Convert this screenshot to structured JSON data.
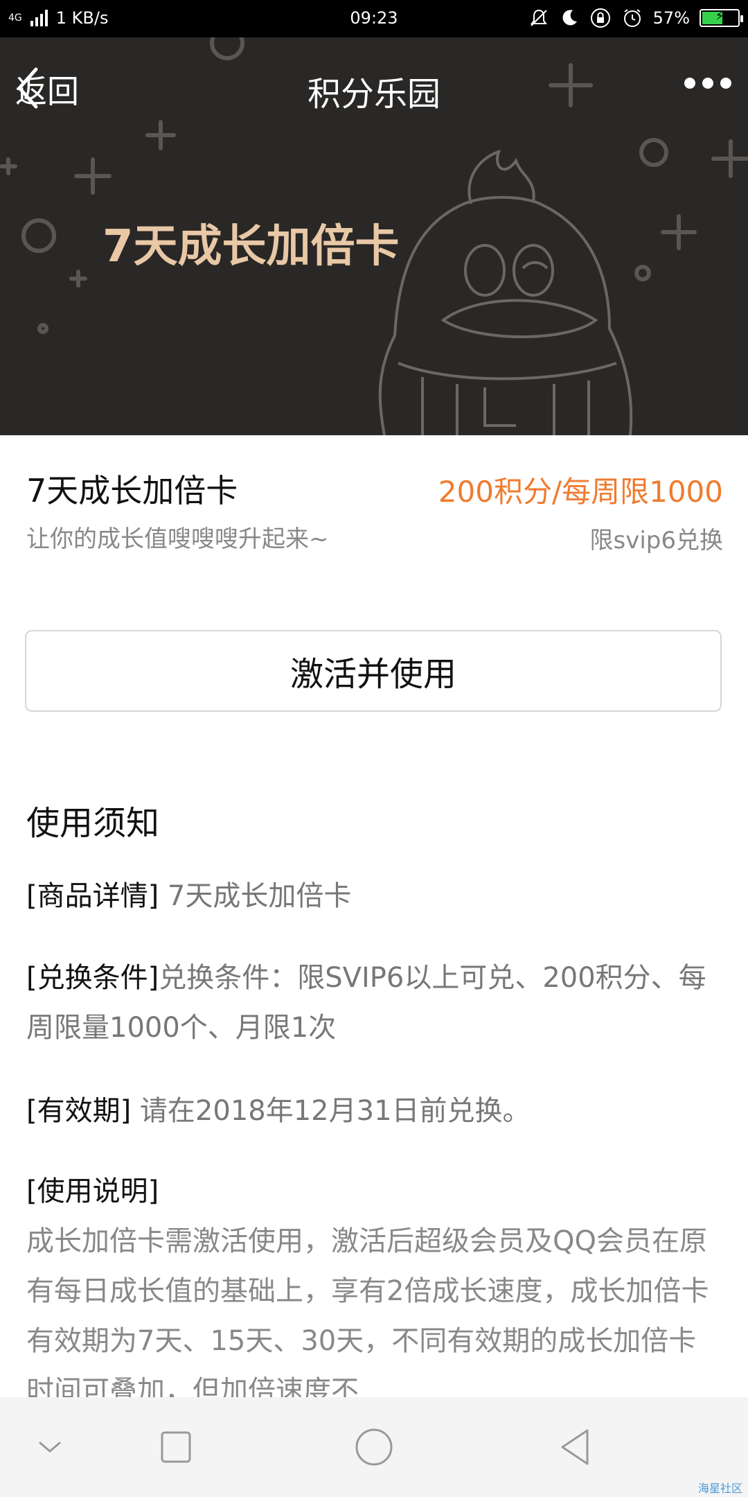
{
  "status_bar": {
    "network": "4G",
    "speed": "1 KB/s",
    "time": "09:23",
    "battery": "57%",
    "battery_level": 0.57
  },
  "header": {
    "back_label": "返回",
    "title": "积分乐园"
  },
  "banner": {
    "title": "7天成长加倍卡"
  },
  "product": {
    "name": "7天成长加倍卡",
    "price": "200积分/每周限1000",
    "subtitle": "让你的成长值嗖嗖嗖升起来~",
    "limit": "限svip6兑换"
  },
  "activate_button": "激活并使用",
  "notice": {
    "heading": "使用须知",
    "items": [
      {
        "tag": "[商品详情]",
        "text": " 7天成长加倍卡"
      },
      {
        "tag": "[兑换条件]",
        "text": "兑换条件：限SVIP6以上可兑、200积分、每周限量1000个、月限1次"
      },
      {
        "tag": "[有效期]",
        "text": " 请在2018年12月31日前兑换。"
      },
      {
        "tag": "[使用说明]",
        "text": "成长加倍卡需激活使用，激活后超级会员及QQ会员在原有每日成长值的基础上，享有2倍成长速度，成长加倍卡有效期为7天、15天、30天，不同有效期的成长加倍卡时间可叠加，但加倍速度不"
      }
    ]
  },
  "watermark": "海星社区",
  "colors": {
    "price": "#f07b2f",
    "banner_bg": "#2a2826",
    "banner_title": "#e9c8a6"
  }
}
